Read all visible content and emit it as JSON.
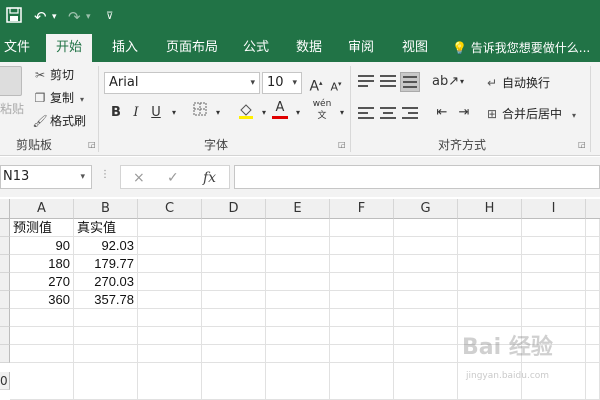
{
  "colors": {
    "brand": "#217346",
    "ribbon": "#f3f3f3",
    "underline_red": "#e00000",
    "highlight_yellow": "#ffef00"
  },
  "quick_access": {
    "save_icon": "save-icon",
    "undo_icon": "undo-icon",
    "redo_icon": "redo-icon",
    "customize_icon": "customize-qat-icon"
  },
  "tabs": [
    "文件",
    "开始",
    "插入",
    "页面布局",
    "公式",
    "数据",
    "审阅",
    "视图"
  ],
  "active_tab": "开始",
  "tell_me": "告诉我您想要做什么...",
  "clipboard": {
    "paste_label": "粘贴",
    "cut_label": "剪切",
    "copy_label": "复制",
    "format_painter_label": "格式刷",
    "group_label": "剪贴板"
  },
  "font": {
    "font_name": "Arial",
    "font_size": "10",
    "grow_label": "A",
    "shrink_label": "A",
    "bold_label": "B",
    "italic_label": "I",
    "underline_label": "U",
    "font_color_label": "A",
    "phonetic_label": "wén",
    "group_label": "字体"
  },
  "alignment": {
    "wrap_text_label": "自动换行",
    "merge_center_label": "合并后居中",
    "group_label": "对齐方式"
  },
  "formula_bar": {
    "name_box": "N13",
    "cancel_icon": "×",
    "enter_icon": "✓",
    "fx_label": "fx",
    "formula": ""
  },
  "sheet": {
    "columns": [
      "A",
      "B",
      "C",
      "D",
      "E",
      "F",
      "G",
      "H",
      "I"
    ],
    "rows": [
      [
        "预测值",
        "真实值"
      ],
      [
        "90",
        "92.03"
      ],
      [
        "180",
        "179.77"
      ],
      [
        "270",
        "270.03"
      ],
      [
        "360",
        "357.78"
      ]
    ],
    "last_row_label": "0"
  },
  "watermark": {
    "text": "Bai 经验",
    "sub": "jingyan.baidu.com"
  }
}
